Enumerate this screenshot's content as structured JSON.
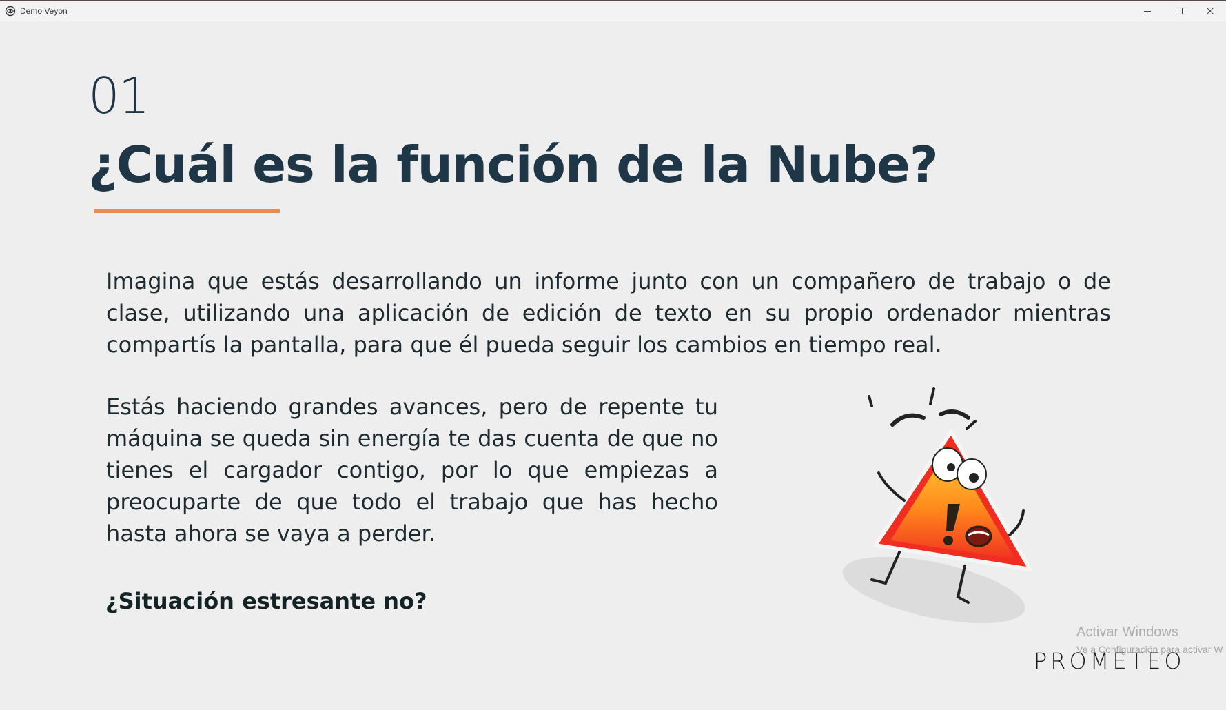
{
  "window": {
    "title": "Demo Veyon",
    "controls": [
      "minimize-icon",
      "maximize-icon",
      "close-icon"
    ]
  },
  "slide": {
    "number": "01",
    "title": "¿Cuál es la función de la Nube?",
    "paragraph_1": "Imagina que estás desarrollando un informe junto con un compañero de trabajo o de clase, utilizando una aplicación de edición de texto en su propio ordenador mientras compartís la pantalla, para que él pueda seguir los cambios en tiempo real.",
    "paragraph_2": "Estás haciendo grandes avances, pero de repente tu máquina se queda sin energía  te das cuenta de que no tienes el cargador contigo, por lo que empiezas a preocuparte de que todo el trabajo que has hecho hasta ahora se vaya a perder.",
    "question": "¿Situación estresante no?",
    "illustration": "stressed-warning-sign-icon",
    "brand": "PROMETEO"
  },
  "watermark": {
    "title": "Activar Windows",
    "subtitle": "Ve a Configuración para activar W"
  },
  "colors": {
    "background": "#eeeeee",
    "title": "#1e3646",
    "accent_underline": "#ea8c4e",
    "body_text": "#1d2b30"
  }
}
